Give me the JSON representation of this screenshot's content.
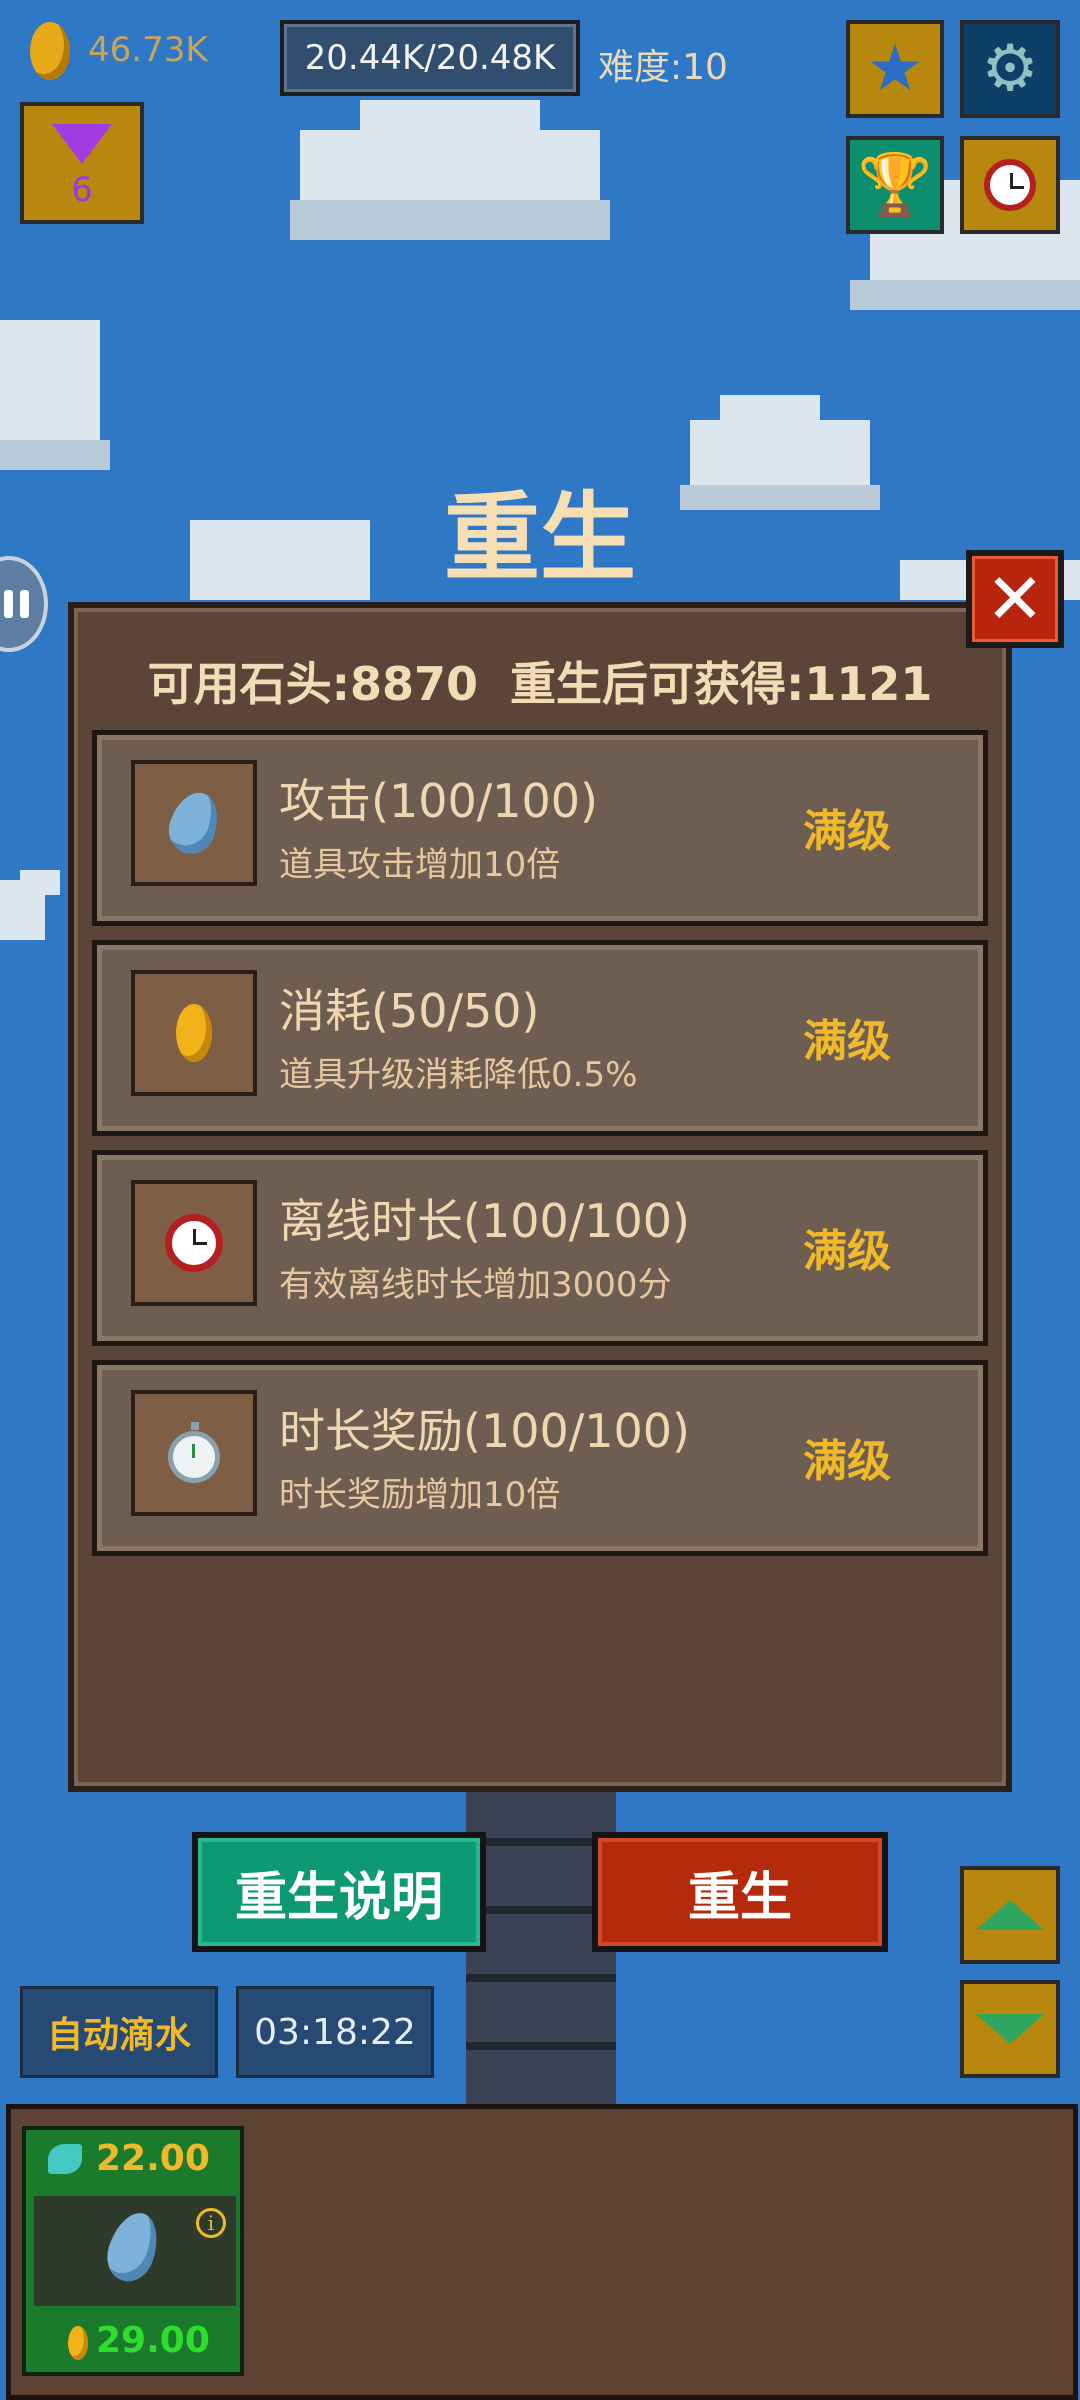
{
  "hud": {
    "coins": "46.73K",
    "hp": "20.44K/20.48K",
    "difficulty": "难度:10",
    "gems": "6"
  },
  "dialog": {
    "title": "重生",
    "info": "可用石头:8870  重生后可获得:1121",
    "upgrades": [
      {
        "title": "攻击(100/100)",
        "desc": "道具攻击增加10倍",
        "status": "满级",
        "icon": "water-drop-icon"
      },
      {
        "title": "消耗(50/50)",
        "desc": "道具升级消耗降低0.5%",
        "status": "满级",
        "icon": "gold-coin-icon"
      },
      {
        "title": "离线时长(100/100)",
        "desc": "有效离线时长增加3000分",
        "status": "满级",
        "icon": "alarm-clock-icon"
      },
      {
        "title": "时长奖励(100/100)",
        "desc": "时长奖励增加10倍",
        "status": "满级",
        "icon": "stopwatch-icon"
      }
    ],
    "explain_button": "重生说明",
    "rebirth_button": "重生"
  },
  "controls": {
    "auto_drip": "自动滴水",
    "timer": "03:18:22"
  },
  "item_card": {
    "attack": "22.00",
    "cost": "29.00"
  },
  "colors": {
    "sky": "#2e78c6",
    "panel": "#5a4538",
    "row": "#6e5e52",
    "accent_gold": "#f0b929",
    "explain_green": "#0d9a73",
    "rebirth_red": "#b62a0c"
  }
}
